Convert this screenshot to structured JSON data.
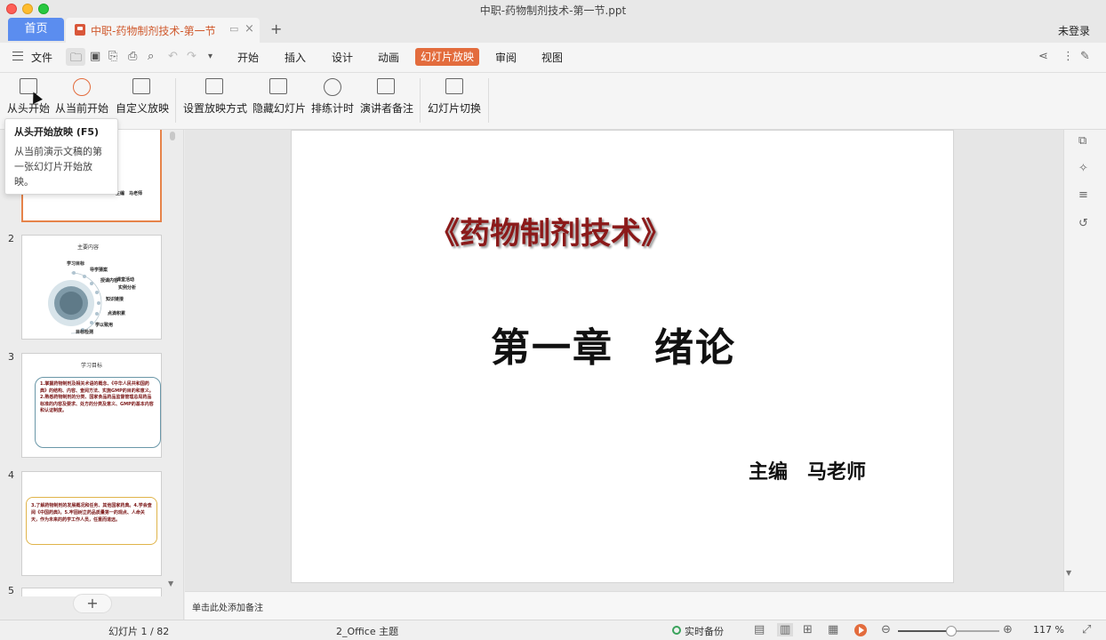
{
  "window": {
    "title": "中职-药物制剂技术-第一节.ppt"
  },
  "tabs": {
    "home": "首页",
    "document": "中职-药物制剂技术-第一节",
    "add": "+",
    "login": "未登录"
  },
  "menu": {
    "file": "文件",
    "items": [
      "开始",
      "插入",
      "设计",
      "动画",
      "幻灯片放映",
      "审阅",
      "视图"
    ],
    "active": "幻灯片放映"
  },
  "ribbon": {
    "buttons": [
      "从头开始",
      "从当前开始",
      "自定义放映",
      "设置放映方式",
      "隐藏幻灯片",
      "排练计时",
      "演讲者备注",
      "幻灯片切换"
    ]
  },
  "tooltip": {
    "title": "从头开始放映 (F5)",
    "body": "从当前演示文稿的第一张幻灯片开始放映。"
  },
  "thumbnails": {
    "numbers": [
      "2",
      "3",
      "4",
      "5"
    ],
    "slide1": {
      "author": "主编　马老师",
      "faded": "绪论"
    },
    "slide2": {
      "title": "主要内容",
      "items": [
        "学习目标",
        "导学猜案",
        "授课内容",
        "课堂活动",
        "实例分析",
        "知识链接",
        "点滴积累",
        "学以致用",
        "目标检测"
      ]
    },
    "slide3": {
      "title": "学习目标",
      "body": "1.掌握药物制剂及相关术语的概念、《中华人民共和国药典》的结构、内容、查阅方法、实施GMP的目的和意义。2.熟悉药物制剂的分类、国家食品药品监督管理总局药品标准的内容及要求、处方的分类及意义、GMP的基本内容和认证制度。"
    },
    "slide4": {
      "body": "3.了解药物制剂的发展概况和任务、其他国家药典。4.学会查阅《中国药典》。5.牢固树立药品质量第一的观点、人命关天，作为未来的药学工作人员，任重而道远。"
    }
  },
  "slide": {
    "book_title": "《药物制剂技术》",
    "chapter": "第一章　绪论",
    "editor": "主编　马老师"
  },
  "notes": {
    "placeholder": "单击此处添加备注"
  },
  "status": {
    "slide_counter": "幻灯片 1 / 82",
    "theme": "2_Office 主题",
    "backup": "实时备份",
    "zoom": "117 %",
    "zoom_fraction": 0.53
  },
  "colors": {
    "accent": "#e36c3d",
    "home_tab": "#5b8def",
    "title_red": "#8b1a1a"
  }
}
